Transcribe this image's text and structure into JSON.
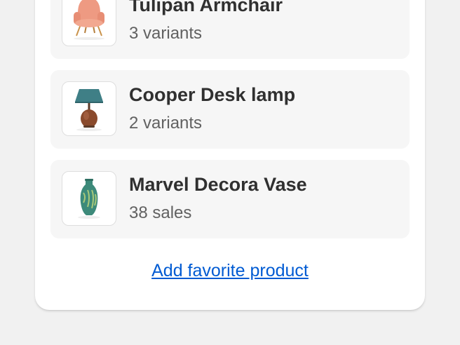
{
  "products": [
    {
      "name": "Tulipan Armchair",
      "meta": "3 variants",
      "image": "armchair-image"
    },
    {
      "name": "Cooper Desk lamp",
      "meta": "2 variants",
      "image": "desk-lamp-image"
    },
    {
      "name": "Marvel Decora Vase",
      "meta": "38 sales",
      "image": "vase-image"
    }
  ],
  "actions": {
    "add_favorite_label": "Add favorite product"
  },
  "colors": {
    "link": "#005bd3",
    "card": "#ffffff",
    "page_background": "#f1f1f1",
    "item_background": "#f6f6f6"
  }
}
